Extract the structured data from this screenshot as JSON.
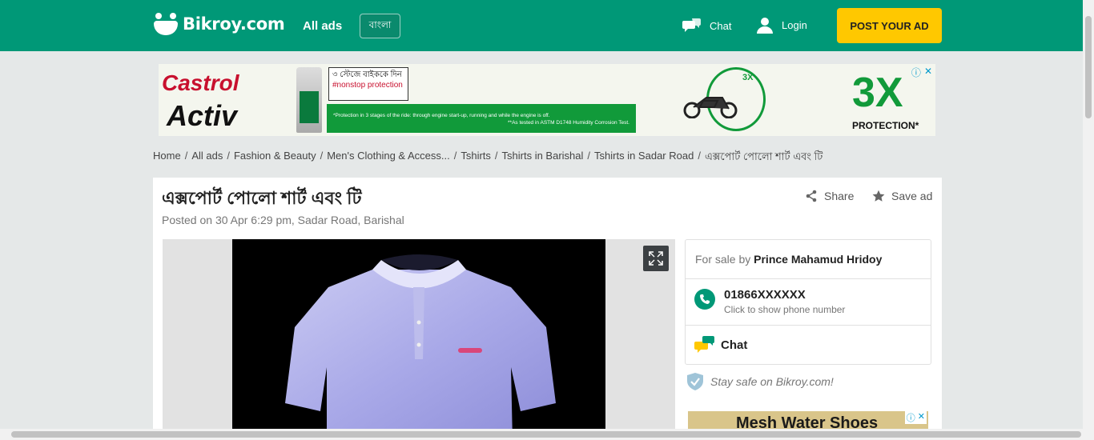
{
  "header": {
    "logo_text": "Bikroy.com",
    "all_ads": "All ads",
    "lang_label": "বাংলা",
    "chat": "Chat",
    "login": "Login",
    "post_ad": "POST YOUR AD",
    "brand_color": "#009877",
    "post_color": "#ffc800"
  },
  "top_ad": {
    "brand_line1": "Castrol",
    "brand_line2": "Activ",
    "tagline_bn": "৩ স্টেজে বাইককে দিন",
    "tagline_tag": "#nonstop protection",
    "fine_print_1": "*Protection in 3 stages of the ride: through engine start-up, running and while the engine is off.",
    "fine_print_2": "**As tested in ASTM D1748 Humidity Corrosion Test.",
    "badge": "3X",
    "big_badge": "3X",
    "protection": "PROTECTION*"
  },
  "breadcrumb": [
    "Home",
    "All ads",
    "Fashion & Beauty",
    "Men's Clothing & Access...",
    "Tshirts",
    "Tshirts in Barishal",
    "Tshirts in Sadar Road",
    "এক্সপোর্ট পোলো শার্ট এবং টি"
  ],
  "listing": {
    "title": "এক্সপোর্ট পোলো শার্ট এবং টি",
    "posted": "Posted on 30 Apr 6:29 pm, Sadar Road, Barishal",
    "share": "Share",
    "save": "Save ad"
  },
  "seller": {
    "for_sale_by": "For sale by",
    "name": "Prince Mahamud Hridoy",
    "phone": "01866XXXXXX",
    "phone_hint": "Click to show phone number",
    "chat": "Chat",
    "safety": "Stay safe on Bikroy.com!"
  },
  "side_ad": {
    "text": "Mesh Water Shoes"
  }
}
